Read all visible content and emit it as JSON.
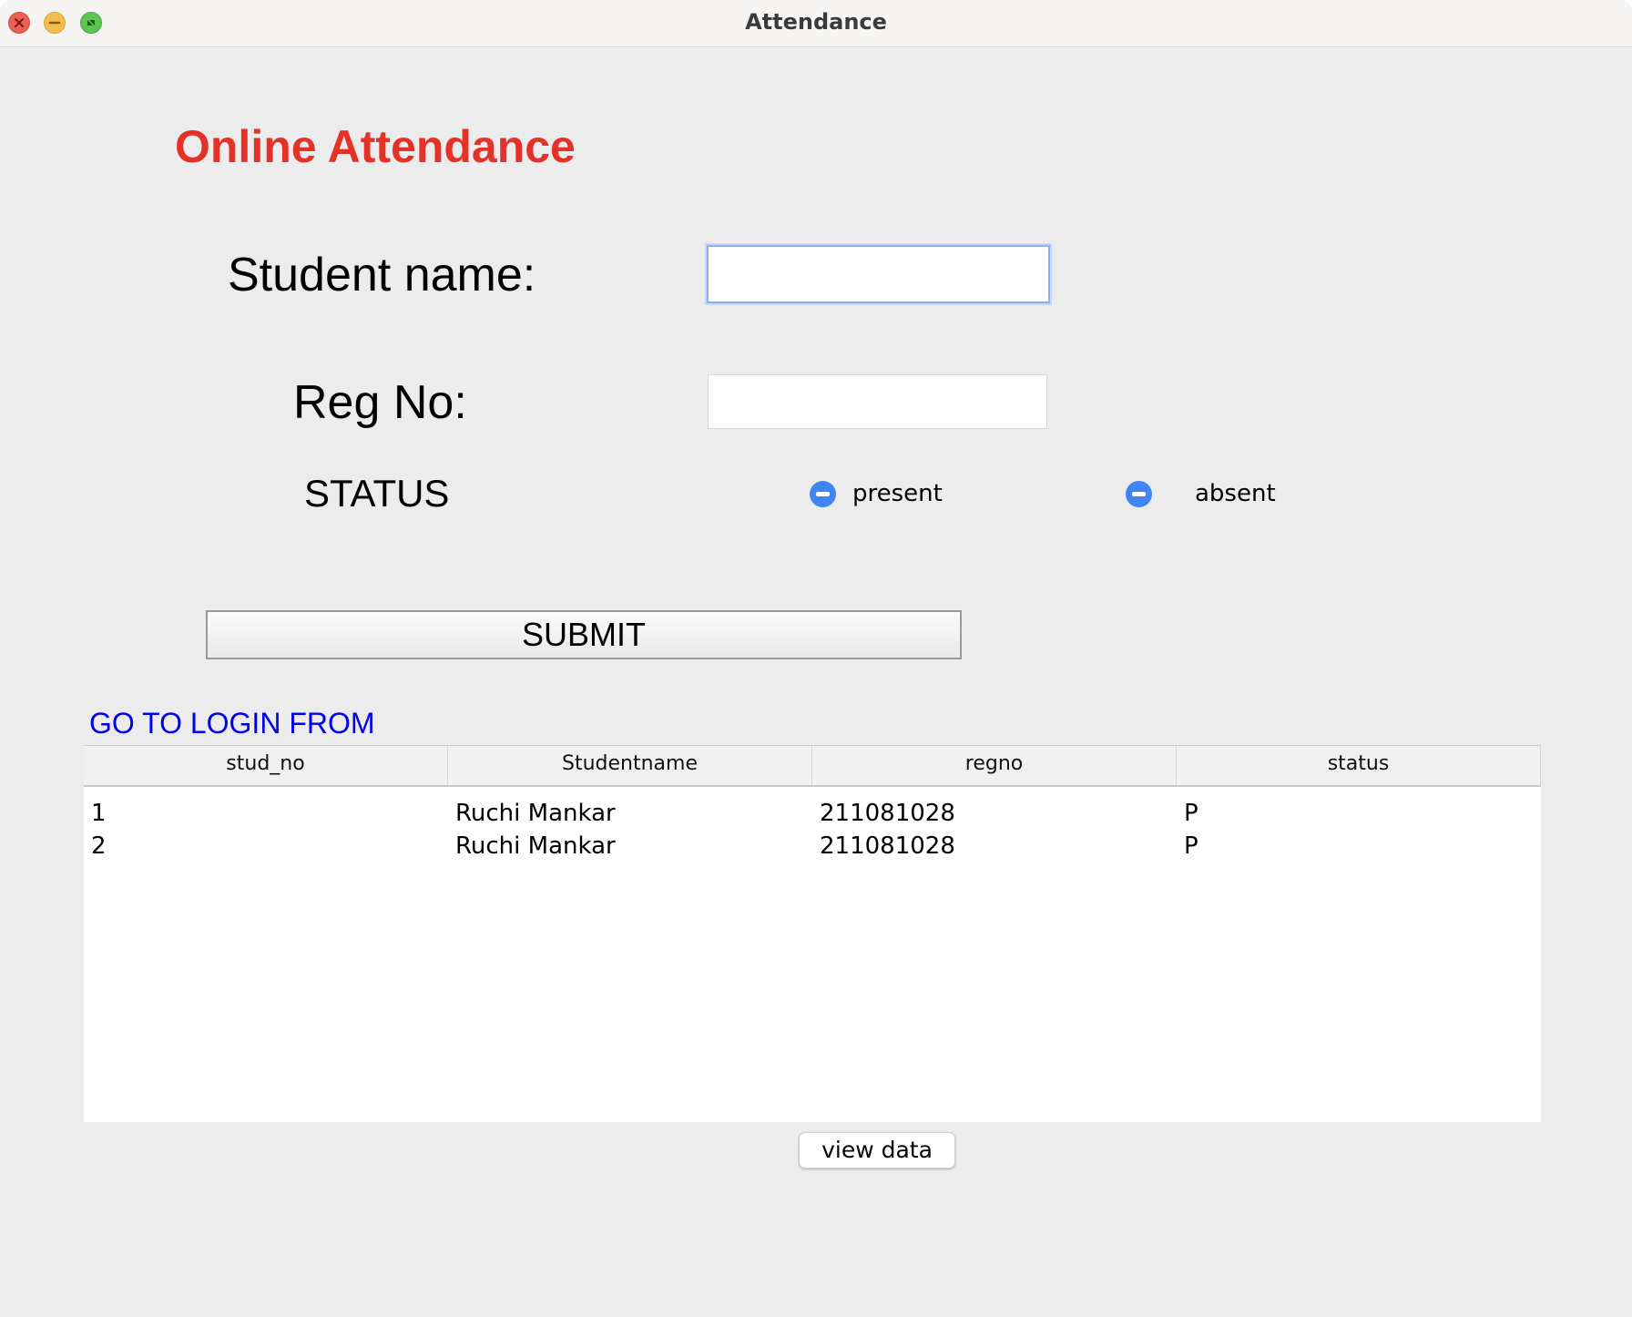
{
  "window": {
    "title": "Attendance",
    "controls": [
      "close-icon",
      "minimize-icon",
      "zoom-icon"
    ]
  },
  "form": {
    "heading": "Online Attendance",
    "student_name_label": "Student name:",
    "student_name_value": "",
    "reg_no_label": "Reg No:",
    "reg_no_value": "",
    "status_label": "STATUS",
    "status_options": [
      {
        "label": "present"
      },
      {
        "label": "absent"
      }
    ],
    "submit_label": "SUBMIT"
  },
  "login_link": "GO TO LOGIN FROM",
  "table": {
    "columns": [
      "stud_no",
      "Studentname",
      "regno",
      "status"
    ],
    "rows": [
      [
        "1",
        "Ruchi Mankar",
        "211081028",
        "P"
      ],
      [
        "2",
        "Ruchi Mankar",
        "211081028",
        "P"
      ]
    ]
  },
  "view_button_label": "view data",
  "colors": {
    "heading": "#e53228",
    "link": "#0000f0",
    "radio": "#3f85f4",
    "window_background": "#ececec"
  }
}
